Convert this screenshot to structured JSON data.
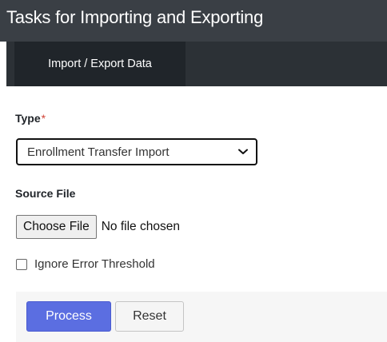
{
  "header": {
    "title": "Tasks for Importing and Exporting"
  },
  "tabs": [
    {
      "label": "Import / Export Data",
      "active": true
    }
  ],
  "form": {
    "type_label": "Type",
    "required_marker": "*",
    "type_selected": "Enrollment Transfer Import",
    "source_file_label": "Source File",
    "choose_file_label": "Choose File",
    "file_status": "No file chosen",
    "ignore_error_label": "Ignore Error Threshold",
    "ignore_error_checked": false
  },
  "actions": {
    "process_label": "Process",
    "reset_label": "Reset"
  },
  "colors": {
    "header_bg": "#3a3f45",
    "tab_strip_bg": "#2c3136",
    "tab_active_bg": "#20252a",
    "required": "#d04437",
    "primary_button": "#5b6ee1",
    "footer_bg": "#f6f6f6"
  }
}
